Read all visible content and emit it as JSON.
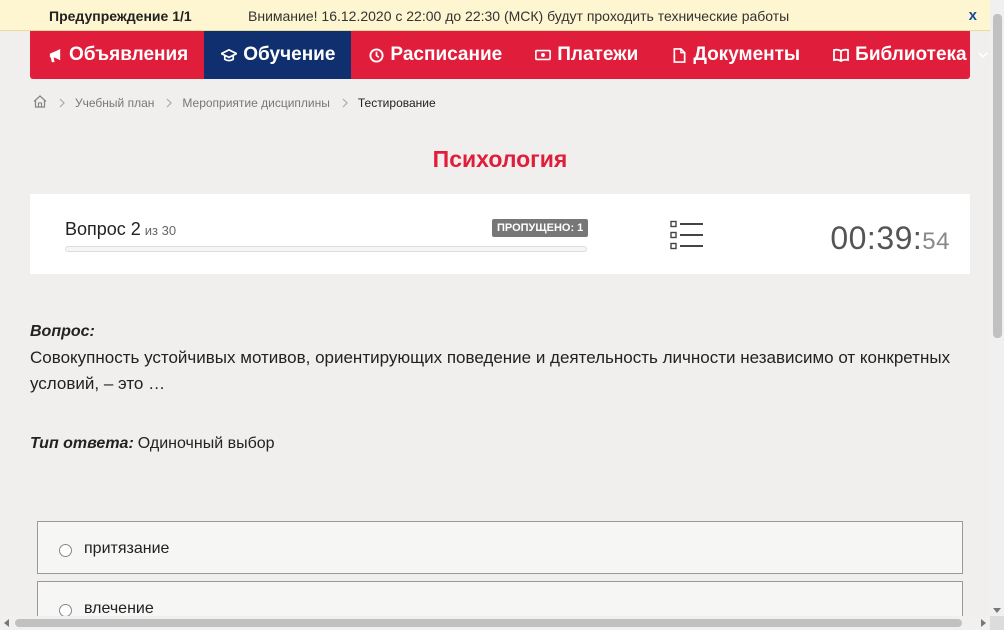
{
  "warning": {
    "title": "Предупреждение 1/1",
    "text": "Внимание! 16.12.2020 с 22:00 до 22:30 (МСК) будут проходить технические работы",
    "close": "x"
  },
  "nav": {
    "items": [
      {
        "label": "Объявления",
        "icon": "megaphone-icon"
      },
      {
        "label": "Обучение",
        "icon": "graduation-cap-icon",
        "active": true
      },
      {
        "label": "Расписание",
        "icon": "clock-icon"
      },
      {
        "label": "Платежи",
        "icon": "money-icon"
      },
      {
        "label": "Документы",
        "icon": "document-icon"
      },
      {
        "label": "Библиотека",
        "icon": "book-icon",
        "dropdown": true
      }
    ]
  },
  "breadcrumb": {
    "home_icon": "home-icon",
    "items": [
      "Учебный план",
      "Мероприятие дисциплины",
      "Тестирование"
    ]
  },
  "page": {
    "title": "Психология"
  },
  "question_panel": {
    "question_label": "Вопрос 2",
    "of_total": "из 30",
    "skipped": "ПРОПУЩЕНО: 1",
    "progress": 0.0,
    "list_icon": "question-list-icon",
    "timer_main": "00:39:",
    "timer_seconds": "54"
  },
  "question": {
    "label": "Вопрос:",
    "text": "Совокупность устойчивых мотивов, ориентирующих поведение и деятельность личности независимо от конкретных условий, – это …",
    "answer_type_label": "Тип ответа:",
    "answer_type": "Одиночный выбор"
  },
  "options": [
    "притязание",
    "влечение"
  ],
  "colors": {
    "accent": "#e01e3c",
    "nav_active": "#0f2f6e",
    "warning_bg": "#fdf6d0"
  }
}
